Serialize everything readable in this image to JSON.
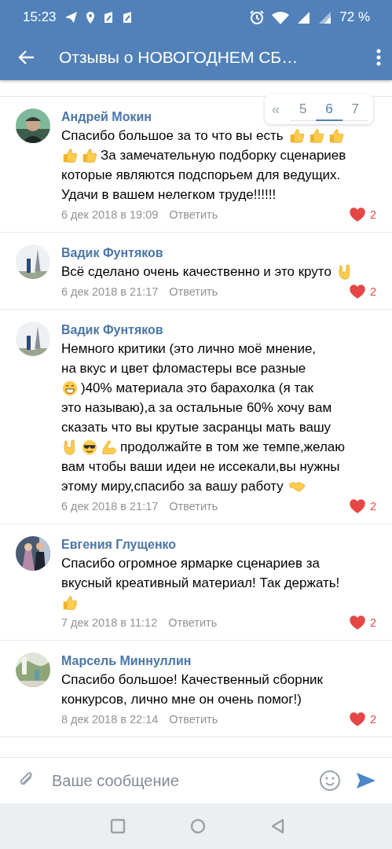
{
  "status_bar": {
    "time": "15:23",
    "battery": "72 %"
  },
  "header": {
    "title": "Отзывы о НОВОГОДНЕМ СБ…"
  },
  "pagination": {
    "first": "«",
    "pages": [
      {
        "label": "5",
        "selected": false
      },
      {
        "label": "6",
        "selected": true
      },
      {
        "label": "7",
        "selected": false
      }
    ]
  },
  "comments": [
    {
      "author": "Андрей Мокин",
      "lines": [
        [
          {
            "kind": "text",
            "text": "Спасибо большое за то что вы есть"
          },
          {
            "kind": "thumbsup"
          },
          {
            "kind": "thumbsup"
          },
          {
            "kind": "thumbsup"
          }
        ],
        [
          {
            "kind": "thumbsup"
          },
          {
            "kind": "thumbsup"
          },
          {
            "kind": "text",
            "text": "За замечательную подборку сценариев"
          }
        ],
        [
          {
            "kind": "text",
            "text": "которые являются подспорьем для ведущих."
          }
        ],
        [
          {
            "kind": "text",
            "text": "Удачи в вашем нелегком труде!!!!!!"
          }
        ]
      ],
      "date": "6 дек 2018 в 19:09",
      "reply": "Ответить",
      "likes": "2",
      "liked": true
    },
    {
      "author": "Вадик Фунтяков",
      "lines": [
        [
          {
            "kind": "text",
            "text": "Всё сделано очень качественно и это круто"
          },
          {
            "kind": "horns"
          }
        ]
      ],
      "date": "6 дек 2018 в 21:17",
      "reply": "Ответить",
      "likes": "2",
      "liked": true
    },
    {
      "author": "Вадик Фунтяков",
      "lines": [
        [
          {
            "kind": "text",
            "text": "Немного критики (это лично моё мнение,"
          }
        ],
        [
          {
            "kind": "text",
            "text": "на вкус и цвет фломастеры все разные"
          }
        ],
        [
          {
            "kind": "grin"
          },
          {
            "kind": "text",
            "text": ")40% материала это барахолка (я так"
          }
        ],
        [
          {
            "kind": "text",
            "text": "это называю),а за остальные 60% хочу вам"
          }
        ],
        [
          {
            "kind": "text",
            "text": "сказать что вы крутые засранцы мать вашу"
          }
        ],
        [
          {
            "kind": "horns"
          },
          {
            "kind": "cool"
          },
          {
            "kind": "muscle"
          },
          {
            "kind": "text",
            "text": "продолжайте в том же темпе,желаю"
          }
        ],
        [
          {
            "kind": "text",
            "text": "вам чтобы ваши идеи не иссекали,вы нужны"
          }
        ],
        [
          {
            "kind": "text",
            "text": "этому миру,спасибо за вашу работу"
          },
          {
            "kind": "handshake"
          }
        ]
      ],
      "date": "6 дек 2018 в 21:17",
      "reply": "Ответить",
      "likes": "2",
      "liked": true
    },
    {
      "author": "Евгения Глущенко",
      "lines": [
        [
          {
            "kind": "text",
            "text": "Спасибо огромное ярмарке сценариев за"
          }
        ],
        [
          {
            "kind": "text",
            "text": "вкусный креативный материал! Так держать!"
          }
        ],
        [
          {
            "kind": "thumbsup"
          }
        ]
      ],
      "date": "7 дек 2018 в 11:12",
      "reply": "Ответить",
      "likes": "2",
      "liked": true
    },
    {
      "author": "Марсель Миннуллин",
      "lines": [
        [
          {
            "kind": "text",
            "text": "Спасибо большое! Качественный сборник"
          }
        ],
        [
          {
            "kind": "text",
            "text": "конкурсов, лично мне он очень помог!)"
          }
        ]
      ],
      "date": "8 дек 2018 в 22:14",
      "reply": "Ответить",
      "likes": "2",
      "liked": true
    }
  ],
  "composer": {
    "placeholder": "Ваше сообщение"
  }
}
